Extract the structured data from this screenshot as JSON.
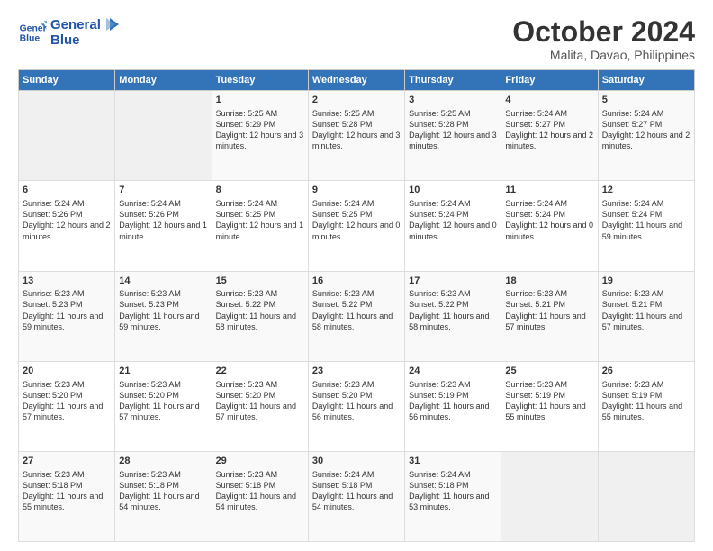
{
  "header": {
    "logo_line1": "General",
    "logo_line2": "Blue",
    "month": "October 2024",
    "location": "Malita, Davao, Philippines"
  },
  "weekdays": [
    "Sunday",
    "Monday",
    "Tuesday",
    "Wednesday",
    "Thursday",
    "Friday",
    "Saturday"
  ],
  "weeks": [
    [
      {
        "day": "",
        "info": ""
      },
      {
        "day": "",
        "info": ""
      },
      {
        "day": "1",
        "info": "Sunrise: 5:25 AM\nSunset: 5:29 PM\nDaylight: 12 hours and 3 minutes."
      },
      {
        "day": "2",
        "info": "Sunrise: 5:25 AM\nSunset: 5:28 PM\nDaylight: 12 hours and 3 minutes."
      },
      {
        "day": "3",
        "info": "Sunrise: 5:25 AM\nSunset: 5:28 PM\nDaylight: 12 hours and 3 minutes."
      },
      {
        "day": "4",
        "info": "Sunrise: 5:24 AM\nSunset: 5:27 PM\nDaylight: 12 hours and 2 minutes."
      },
      {
        "day": "5",
        "info": "Sunrise: 5:24 AM\nSunset: 5:27 PM\nDaylight: 12 hours and 2 minutes."
      }
    ],
    [
      {
        "day": "6",
        "info": "Sunrise: 5:24 AM\nSunset: 5:26 PM\nDaylight: 12 hours and 2 minutes."
      },
      {
        "day": "7",
        "info": "Sunrise: 5:24 AM\nSunset: 5:26 PM\nDaylight: 12 hours and 1 minute."
      },
      {
        "day": "8",
        "info": "Sunrise: 5:24 AM\nSunset: 5:25 PM\nDaylight: 12 hours and 1 minute."
      },
      {
        "day": "9",
        "info": "Sunrise: 5:24 AM\nSunset: 5:25 PM\nDaylight: 12 hours and 0 minutes."
      },
      {
        "day": "10",
        "info": "Sunrise: 5:24 AM\nSunset: 5:24 PM\nDaylight: 12 hours and 0 minutes."
      },
      {
        "day": "11",
        "info": "Sunrise: 5:24 AM\nSunset: 5:24 PM\nDaylight: 12 hours and 0 minutes."
      },
      {
        "day": "12",
        "info": "Sunrise: 5:24 AM\nSunset: 5:24 PM\nDaylight: 11 hours and 59 minutes."
      }
    ],
    [
      {
        "day": "13",
        "info": "Sunrise: 5:23 AM\nSunset: 5:23 PM\nDaylight: 11 hours and 59 minutes."
      },
      {
        "day": "14",
        "info": "Sunrise: 5:23 AM\nSunset: 5:23 PM\nDaylight: 11 hours and 59 minutes."
      },
      {
        "day": "15",
        "info": "Sunrise: 5:23 AM\nSunset: 5:22 PM\nDaylight: 11 hours and 58 minutes."
      },
      {
        "day": "16",
        "info": "Sunrise: 5:23 AM\nSunset: 5:22 PM\nDaylight: 11 hours and 58 minutes."
      },
      {
        "day": "17",
        "info": "Sunrise: 5:23 AM\nSunset: 5:22 PM\nDaylight: 11 hours and 58 minutes."
      },
      {
        "day": "18",
        "info": "Sunrise: 5:23 AM\nSunset: 5:21 PM\nDaylight: 11 hours and 57 minutes."
      },
      {
        "day": "19",
        "info": "Sunrise: 5:23 AM\nSunset: 5:21 PM\nDaylight: 11 hours and 57 minutes."
      }
    ],
    [
      {
        "day": "20",
        "info": "Sunrise: 5:23 AM\nSunset: 5:20 PM\nDaylight: 11 hours and 57 minutes."
      },
      {
        "day": "21",
        "info": "Sunrise: 5:23 AM\nSunset: 5:20 PM\nDaylight: 11 hours and 57 minutes."
      },
      {
        "day": "22",
        "info": "Sunrise: 5:23 AM\nSunset: 5:20 PM\nDaylight: 11 hours and 57 minutes."
      },
      {
        "day": "23",
        "info": "Sunrise: 5:23 AM\nSunset: 5:20 PM\nDaylight: 11 hours and 56 minutes."
      },
      {
        "day": "24",
        "info": "Sunrise: 5:23 AM\nSunset: 5:19 PM\nDaylight: 11 hours and 56 minutes."
      },
      {
        "day": "25",
        "info": "Sunrise: 5:23 AM\nSunset: 5:19 PM\nDaylight: 11 hours and 55 minutes."
      },
      {
        "day": "26",
        "info": "Sunrise: 5:23 AM\nSunset: 5:19 PM\nDaylight: 11 hours and 55 minutes."
      }
    ],
    [
      {
        "day": "27",
        "info": "Sunrise: 5:23 AM\nSunset: 5:18 PM\nDaylight: 11 hours and 55 minutes."
      },
      {
        "day": "28",
        "info": "Sunrise: 5:23 AM\nSunset: 5:18 PM\nDaylight: 11 hours and 54 minutes."
      },
      {
        "day": "29",
        "info": "Sunrise: 5:23 AM\nSunset: 5:18 PM\nDaylight: 11 hours and 54 minutes."
      },
      {
        "day": "30",
        "info": "Sunrise: 5:24 AM\nSunset: 5:18 PM\nDaylight: 11 hours and 54 minutes."
      },
      {
        "day": "31",
        "info": "Sunrise: 5:24 AM\nSunset: 5:18 PM\nDaylight: 11 hours and 53 minutes."
      },
      {
        "day": "",
        "info": ""
      },
      {
        "day": "",
        "info": ""
      }
    ]
  ]
}
